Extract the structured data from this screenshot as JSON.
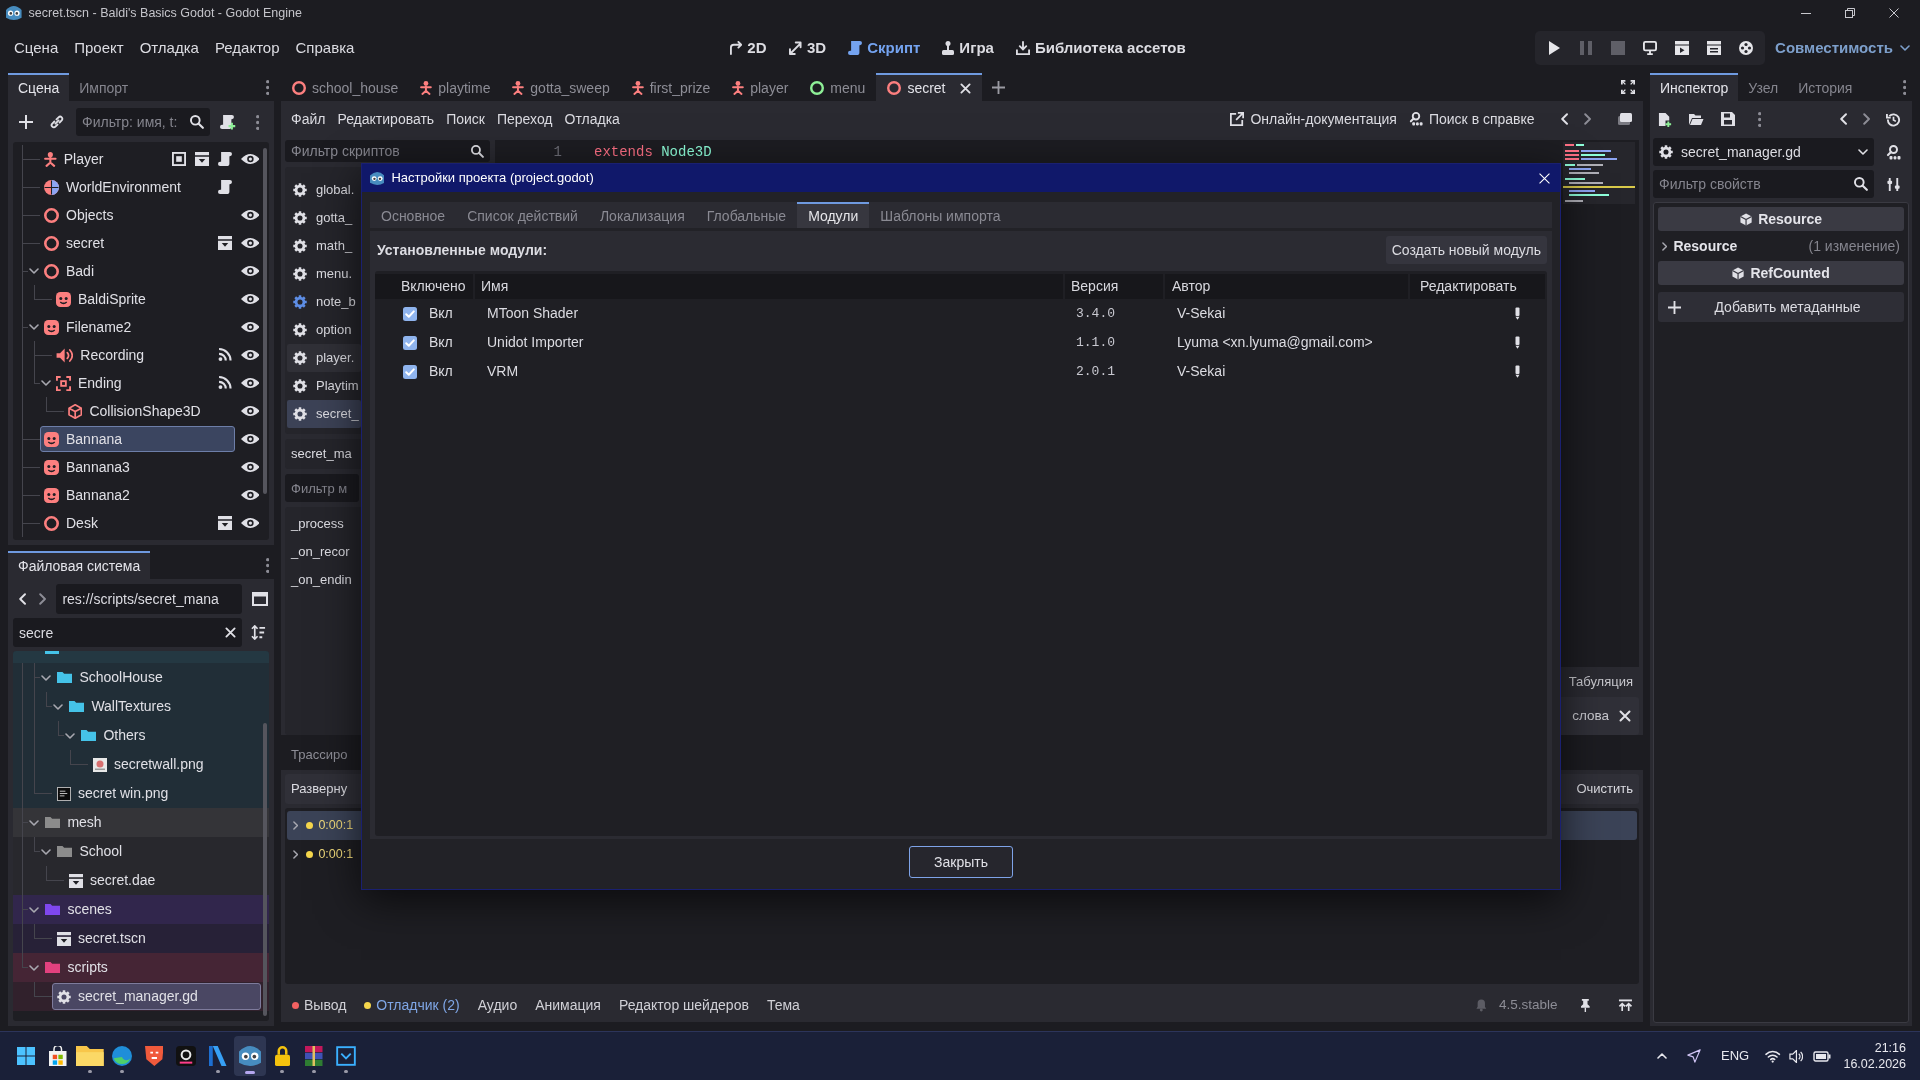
{
  "window": {
    "title": "secret.tscn - Baldi's Basics Godot - Godot Engine"
  },
  "menu": [
    {
      "label": "Сцена"
    },
    {
      "label": "Проект"
    },
    {
      "label": "Отладка"
    },
    {
      "label": "Редактор"
    },
    {
      "label": "Справка"
    }
  ],
  "workspaces": [
    {
      "kind": "canvas",
      "label": "2D",
      "selected": false
    },
    {
      "kind": "spatial",
      "label": "3D",
      "selected": false
    },
    {
      "kind": "script",
      "label": "Скрипт",
      "selected": true
    },
    {
      "kind": "game",
      "label": "Игра",
      "selected": false
    },
    {
      "kind": "assetlib",
      "label": "Библиотека ассетов",
      "selected": false
    }
  ],
  "run_bar": [
    {
      "kind": "play",
      "disabled": false
    },
    {
      "kind": "pause",
      "disabled": true
    },
    {
      "kind": "stop",
      "disabled": true
    },
    {
      "kind": "remote",
      "disabled": false
    },
    {
      "kind": "play_scene",
      "disabled": false
    },
    {
      "kind": "play_custom",
      "disabled": false
    },
    {
      "kind": "movie",
      "disabled": false
    }
  ],
  "renderer": "Совместимость",
  "scene_dock": {
    "tabs": [
      {
        "label": "Сцена",
        "selected": true
      },
      {
        "label": "Импорт",
        "selected": false
      }
    ],
    "filter": {
      "placeholder": "Фильтр: имя, t:"
    },
    "tree": [
      {
        "name": "Player",
        "kind": "character",
        "badges": [
          {
            "kind": "unique"
          },
          {
            "kind": "scene"
          },
          {
            "kind": "script"
          }
        ],
        "visibility_toggle": true,
        "selected": false
      },
      {
        "name": "WorldEnvironment",
        "kind": "environment",
        "badges": [
          {
            "kind": "script"
          }
        ],
        "visibility_toggle": false,
        "selected": false
      },
      {
        "name": "Objects",
        "kind": "node3d",
        "visibility_toggle": true,
        "selected": false
      },
      {
        "name": "secret",
        "kind": "node3d",
        "badges": [
          {
            "kind": "scene"
          }
        ],
        "visibility_toggle": true,
        "selected": false
      },
      {
        "name": "Badi",
        "kind": "node3d",
        "visibility_toggle": true,
        "selected": false,
        "expanded": true,
        "children": [
          {
            "name": "BaldiSprite",
            "kind": "sprite",
            "visibility_toggle": true,
            "selected": false
          }
        ]
      },
      {
        "name": "Filename2",
        "kind": "sprite",
        "visibility_toggle": true,
        "selected": false,
        "expanded": true,
        "children": [
          {
            "name": "Recording",
            "kind": "audio",
            "badges": [
              {
                "kind": "signals"
              }
            ],
            "visibility_toggle": true,
            "selected": false
          },
          {
            "name": "Ending",
            "kind": "area",
            "badges": [
              {
                "kind": "signals"
              }
            ],
            "visibility_toggle": true,
            "selected": false,
            "expanded": true,
            "children": [
              {
                "name": "CollisionShape3D",
                "kind": "collision",
                "visibility_toggle": true,
                "selected": false
              }
            ]
          }
        ]
      },
      {
        "name": "Bannana",
        "kind": "sprite",
        "visibility_toggle": true,
        "selected": true
      },
      {
        "name": "Bannana3",
        "kind": "sprite",
        "visibility_toggle": true,
        "selected": false
      },
      {
        "name": "Bannana2",
        "kind": "sprite",
        "visibility_toggle": true,
        "selected": false
      },
      {
        "name": "Desk",
        "kind": "node3d",
        "badges": [
          {
            "kind": "scene"
          }
        ],
        "visibility_toggle": true,
        "selected": false
      }
    ]
  },
  "filesystem": {
    "tabs": [
      {
        "label": "Файловая система",
        "selected": true
      }
    ],
    "path": "res://scripts/secret_mana",
    "search": "secre",
    "scrolled_folder": {
      "color": "#45c3e8",
      "children": [
        {
          "name": "SchoolHouse",
          "kind": "folder",
          "expanded": true,
          "selected": false,
          "children": [
            {
              "name": "WallTextures",
              "kind": "folder",
              "expanded": true,
              "selected": false,
              "children": [
                {
                  "name": "Others",
                  "kind": "folder",
                  "expanded": true,
                  "selected": false,
                  "children": [
                    {
                      "name": "secretwall.png",
                      "kind": "image",
                      "selected": false
                    }
                  ]
                }
              ]
            }
          ]
        },
        {
          "name": "secret win.png",
          "kind": "image_text",
          "selected": false
        }
      ]
    },
    "tree": [
      {
        "name": "mesh",
        "kind": "folder",
        "color": "#8c8c8c",
        "expanded": true,
        "selected": false,
        "children": [
          {
            "name": "School",
            "kind": "folder",
            "expanded": true,
            "selected": false,
            "children": [
              {
                "name": "secret.dae",
                "kind": "scene",
                "selected": false
              }
            ]
          }
        ]
      },
      {
        "name": "scenes",
        "kind": "folder",
        "color": "#7f47ee",
        "expanded": true,
        "selected": false,
        "children": [
          {
            "name": "secret.tscn",
            "kind": "scene",
            "selected": false
          }
        ]
      },
      {
        "name": "scripts",
        "kind": "folder",
        "color": "#e2417e",
        "expanded": true,
        "selected": false,
        "children": [
          {
            "name": "secret_manager.gd",
            "kind": "script",
            "selected": true
          }
        ]
      }
    ]
  },
  "script_tabs": [
    {
      "label": "school_house",
      "kind": "node3d",
      "selected": false
    },
    {
      "label": "playtime",
      "kind": "character",
      "selected": false
    },
    {
      "label": "gotta_sweep",
      "kind": "character",
      "selected": false
    },
    {
      "label": "first_prize",
      "kind": "character",
      "selected": false
    },
    {
      "label": "player",
      "kind": "character",
      "selected": false
    },
    {
      "label": "menu",
      "kind": "control",
      "selected": false
    },
    {
      "label": "secret",
      "kind": "node3d",
      "selected": true
    }
  ],
  "script_editor": {
    "menu": [
      "Файл",
      "Редактировать",
      "Поиск",
      "Переход",
      "Отладка"
    ],
    "links": [
      {
        "kind": "online_docs",
        "label": "Онлайн-документация"
      },
      {
        "kind": "search_help",
        "label": "Поиск в справке"
      }
    ],
    "script_filter": {
      "placeholder": "Фильтр скриптов"
    },
    "scripts": [
      {
        "name": "global.",
        "color": "#e0e0e6",
        "selected": false,
        "hovered": false
      },
      {
        "name": "gotta_",
        "color": "#e0e0e6",
        "selected": false,
        "hovered": false
      },
      {
        "name": "math_",
        "color": "#e0e0e6",
        "selected": false,
        "hovered": false
      },
      {
        "name": "menu.",
        "color": "#e0e0e6",
        "selected": false,
        "hovered": false
      },
      {
        "name": "note_b",
        "color": "#5e8ee6",
        "selected": false,
        "hovered": false
      },
      {
        "name": "option",
        "color": "#e0e0e6",
        "selected": false,
        "hovered": false
      },
      {
        "name": "player.",
        "color": "#e0e0e6",
        "selected": false,
        "hovered": true
      },
      {
        "name": "Playtim",
        "color": "#e0e0e6",
        "selected": false,
        "hovered": false
      },
      {
        "name": "secret_",
        "color": "#e0e0e6",
        "selected": true,
        "hovered": false
      }
    ],
    "current_script": "secret_ma",
    "method_filter": {
      "placeholder": "Фильтр м"
    },
    "methods": [
      "_process",
      "_on_recor",
      "_on_endin"
    ],
    "code": [
      {
        "number": "1",
        "tokens": [
          {
            "kind": "keyword",
            "text": "extends"
          },
          {
            "kind": "type",
            "text": "Node3D"
          }
        ]
      }
    ],
    "indent_mode": "Табуляция",
    "find_option": "слова"
  },
  "debugger": {
    "tab": "Трассиро",
    "expand_button": "Разверну",
    "clear_button": "Очистить",
    "rows": [
      {
        "time": "0:00:1",
        "color": "#f5d64c",
        "selected": true
      },
      {
        "time": "0:00:1",
        "color": "#f5d64c",
        "selected": false
      }
    ]
  },
  "bottom_tabs": [
    {
      "label": "Вывод",
      "color": "#f26161",
      "selected": false
    },
    {
      "label": "Отладчик (2)",
      "color": "#f5d64c",
      "selected": true
    },
    {
      "label": "Аудио",
      "selected": false
    },
    {
      "label": "Анимация",
      "selected": false
    },
    {
      "label": "Редактор шейдеров",
      "selected": false
    },
    {
      "label": "Тема",
      "selected": false
    }
  ],
  "version": "4.5.stable",
  "inspector": {
    "tabs": [
      {
        "label": "Инспектор",
        "selected": true
      },
      {
        "label": "Узел",
        "selected": false
      },
      {
        "label": "История",
        "selected": false
      }
    ],
    "resource": "secret_manager.gd",
    "filter": {
      "placeholder": "Фильтр свойств"
    },
    "sections": [
      {
        "kind": "category",
        "label": "Resource"
      },
      {
        "kind": "group",
        "label": "Resource",
        "note": "(1 изменение)",
        "expanded": false
      },
      {
        "kind": "category",
        "label": "RefCounted"
      }
    ],
    "add_metadata": "Добавить метаданные"
  },
  "dialog": {
    "title": "Настройки проекта (project.godot)",
    "tabs": [
      {
        "label": "Основное",
        "selected": false
      },
      {
        "label": "Список действий",
        "selected": false
      },
      {
        "label": "Локализация",
        "selected": false
      },
      {
        "label": "Глобальные",
        "selected": false
      },
      {
        "label": "Модули",
        "selected": true
      },
      {
        "label": "Шаблоны импорта",
        "selected": false
      }
    ],
    "heading": "Установленные модули:",
    "create_button": "Создать новый модуль",
    "columns": [
      "Включено",
      "Имя",
      "Версия",
      "Автор",
      "Редактировать"
    ],
    "rows": [
      {
        "enabled": true,
        "status": "Вкл",
        "name": "MToon Shader",
        "version": "3.4.0",
        "author": "V-Sekai"
      },
      {
        "enabled": true,
        "status": "Вкл",
        "name": "Unidot Importer",
        "version": "1.1.0",
        "author": "Lyuma <xn.lyuma@gmail.com>"
      },
      {
        "enabled": true,
        "status": "Вкл",
        "name": "VRM",
        "version": "2.0.1",
        "author": "V-Sekai"
      }
    ],
    "close_button": "Закрыть"
  },
  "taskbar": {
    "apps": [
      {
        "kind": "start",
        "running": false,
        "active": false
      },
      {
        "kind": "store",
        "running": false,
        "active": false
      },
      {
        "kind": "explorer",
        "running": true,
        "active": false
      },
      {
        "kind": "edge",
        "running": true,
        "active": false
      },
      {
        "kind": "shield",
        "running": false,
        "active": false
      },
      {
        "kind": "dark_square",
        "running": false,
        "active": false
      },
      {
        "kind": "ribbon",
        "running": true,
        "active": false
      },
      {
        "kind": "godot",
        "running": true,
        "active": true
      },
      {
        "kind": "padlock",
        "running": true,
        "active": false
      },
      {
        "kind": "books",
        "running": true,
        "active": false
      },
      {
        "kind": "framed",
        "running": true,
        "active": false
      }
    ],
    "language": "ENG",
    "time": "21:16",
    "date": "16.02.2026"
  }
}
